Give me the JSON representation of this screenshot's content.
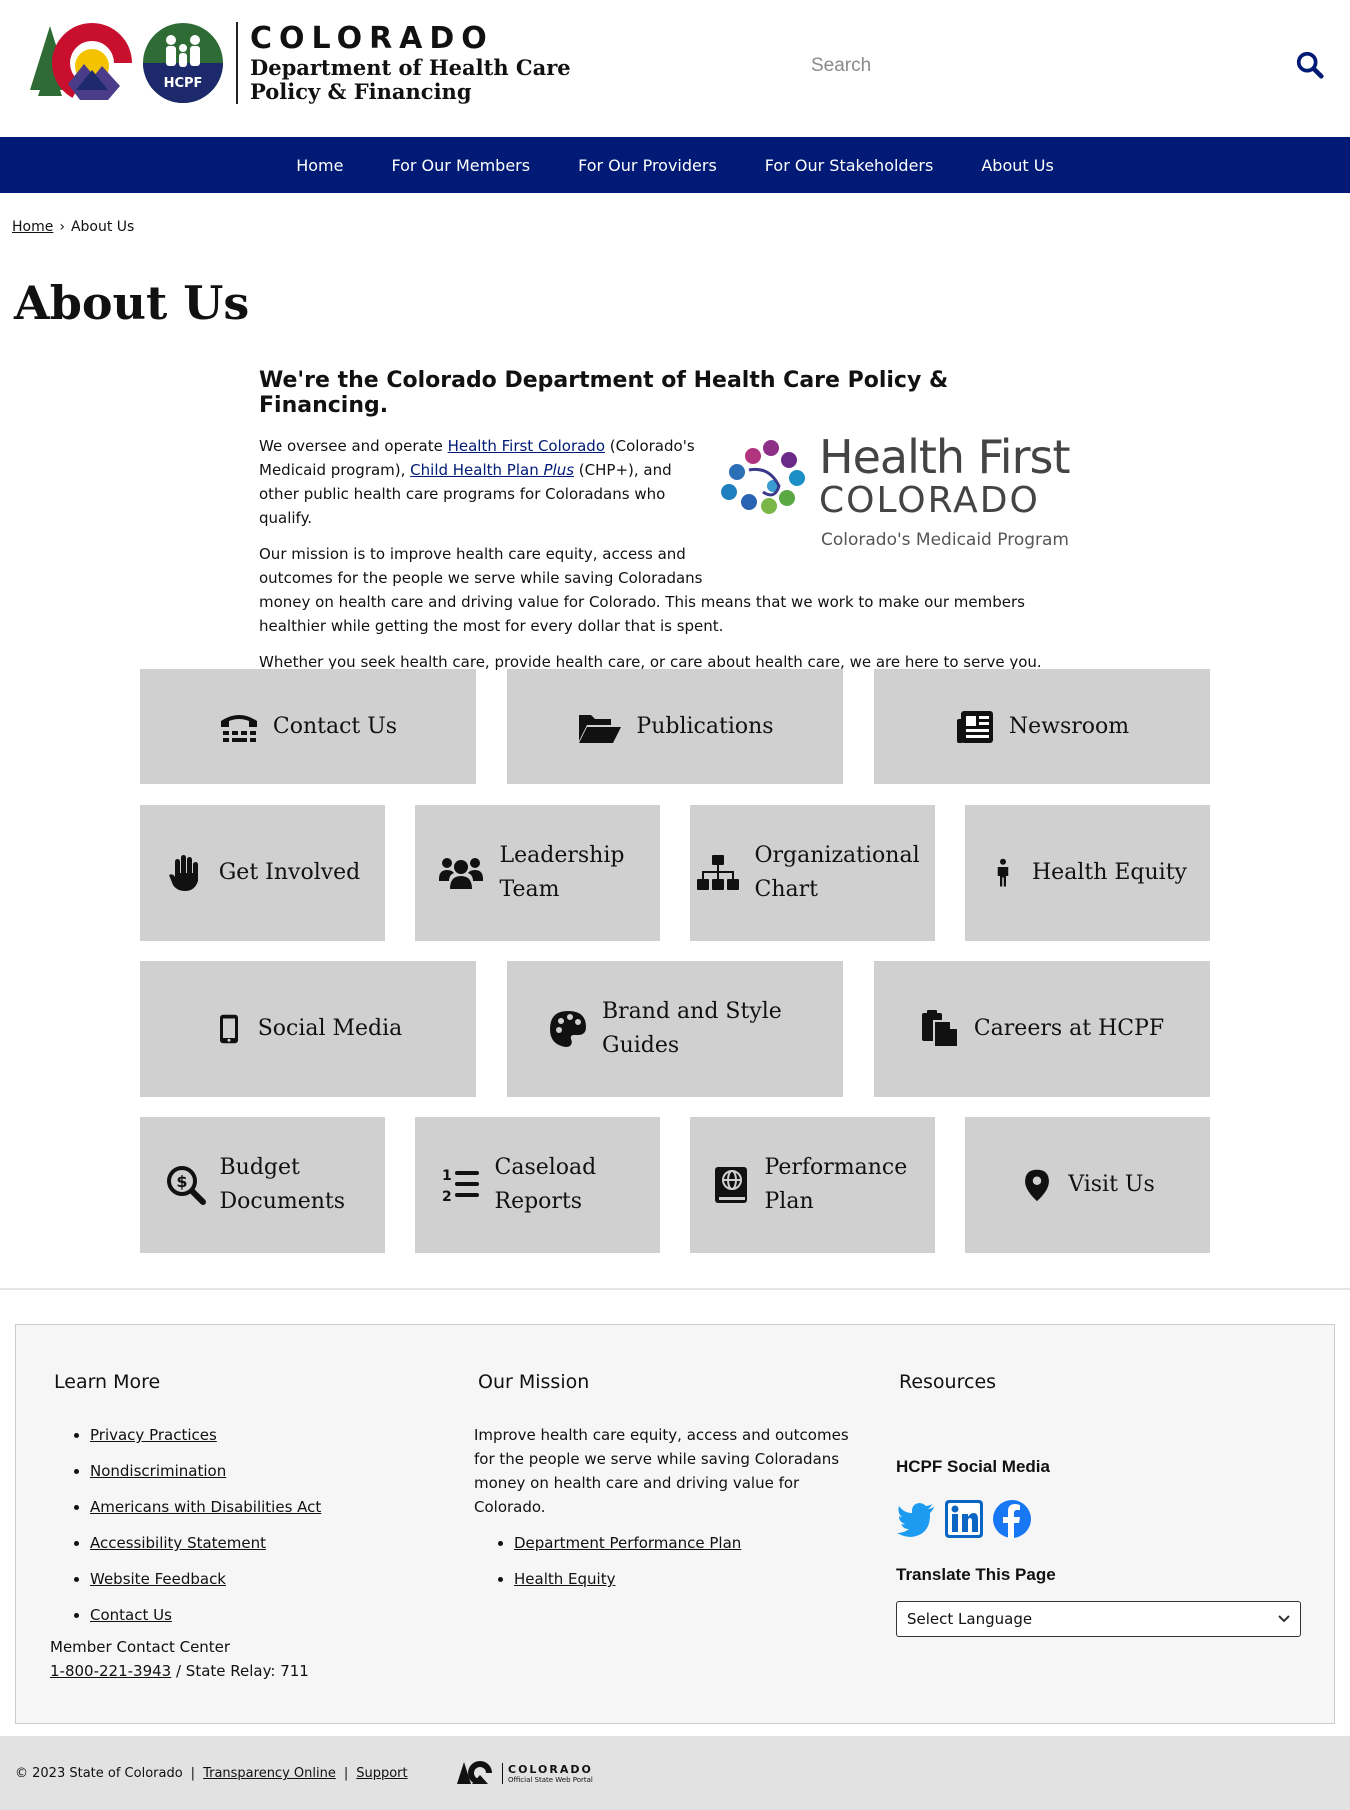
{
  "header": {
    "brand_word": "COLORADO",
    "dept_line1": "Department of Health Care",
    "dept_line2": "Policy & Financing",
    "hcpf_badge": "HCPF",
    "search_placeholder": "Search"
  },
  "nav": {
    "items": [
      {
        "label": "Home"
      },
      {
        "label": "For Our Members"
      },
      {
        "label": "For Our Providers"
      },
      {
        "label": "For Our Stakeholders"
      },
      {
        "label": "About Us"
      }
    ]
  },
  "breadcrumb": {
    "home": "Home",
    "separator": "›",
    "current": "About Us"
  },
  "page_title": "About Us",
  "intro": {
    "heading": "We're the Colorado Department of Health Care Policy & Financing.",
    "p1_pre": "We oversee and operate ",
    "p1_link1": "Health First Colorado",
    "p1_mid": " (Colorado's Medicaid program), ",
    "p1_link2_a": "Child Health Plan ",
    "p1_link2_b": "Plus",
    "p1_post": " (CHP+), and other public health care programs for Coloradans who qualify.",
    "p2": "Our mission is to improve health care equity, access and outcomes for the people we serve while saving Coloradans money on health care and driving value for Colorado. This means that we work to make our members healthier while getting the most for every dollar that is spent.",
    "p3": "Whether you seek health care, provide health care, or care about health care, we are here to serve you.",
    "hfc_title": "Health First",
    "hfc_colorado": "COLORADO",
    "hfc_sub": "Colorado's Medicaid Program"
  },
  "tiles": [
    {
      "label": "Contact Us",
      "icon": "tty-phone-icon"
    },
    {
      "label": "Publications",
      "icon": "folder-open-icon"
    },
    {
      "label": "Newsroom",
      "icon": "newspaper-icon"
    },
    {
      "label": "Get Involved",
      "icon": "raised-hand-icon"
    },
    {
      "label": "Leadership Team",
      "icon": "users-icon"
    },
    {
      "label": "Organizational Chart",
      "icon": "sitemap-icon"
    },
    {
      "label": "Health Equity",
      "icon": "person-icon"
    },
    {
      "label": "Social Media",
      "icon": "mobile-icon"
    },
    {
      "label": "Brand and Style Guides",
      "icon": "palette-icon"
    },
    {
      "label": "Careers at HCPF",
      "icon": "clipboard-copy-icon"
    },
    {
      "label": "Budget Documents",
      "icon": "dollar-search-icon"
    },
    {
      "label": "Caseload Reports",
      "icon": "numbered-list-icon"
    },
    {
      "label": "Performance Plan",
      "icon": "atlas-book-icon"
    },
    {
      "label": "Visit Us",
      "icon": "map-pin-icon"
    }
  ],
  "footer": {
    "learn_more": {
      "heading": "Learn More",
      "links": [
        "Privacy Practices",
        "Nondiscrimination",
        "Americans with Disabilities Act",
        "Accessibility Statement",
        "Website Feedback",
        "Contact Us"
      ],
      "mcc_label": "Member Contact Center",
      "mcc_phone": "1-800-221-3943",
      "mcc_relay": " / State Relay: 711"
    },
    "mission": {
      "heading": "Our Mission",
      "text": "Improve health care equity, access and outcomes for the people we serve while saving Coloradans money on health care and driving value for Colorado.",
      "links": [
        "Department Performance Plan",
        "Health Equity"
      ]
    },
    "resources": {
      "heading": "Resources",
      "social_heading": "HCPF Social Media",
      "translate_heading": "Translate This Page",
      "language_selected": "Select Language"
    }
  },
  "bottom": {
    "copyright": "© 2023 State of Colorado",
    "transparency": "Transparency Online",
    "support": "Support",
    "portal_word": "COLORADO",
    "portal_sub": "Official State Web Portal"
  },
  "colors": {
    "nav_bg": "#001a75",
    "tile_bg": "#d0d0d0",
    "twitter": "#1d9bf0",
    "linkedin": "#0a66c2",
    "facebook": "#1877f2"
  }
}
